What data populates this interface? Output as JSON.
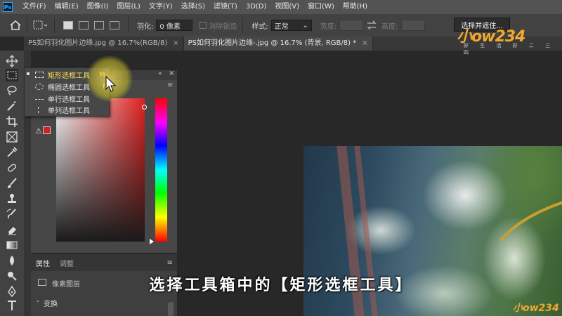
{
  "app": {
    "logo": "Ps"
  },
  "menu": [
    "文件(F)",
    "编辑(E)",
    "图像(I)",
    "图层(L)",
    "文字(Y)",
    "选择(S)",
    "滤镜(T)",
    "3D(D)",
    "视图(V)",
    "窗口(W)",
    "帮助(H)"
  ],
  "options": {
    "feather_label": "羽化:",
    "feather_value": "0 像素",
    "antialias_label": "消除锯齿",
    "style_label": "样式:",
    "style_value": "正常",
    "width_label": "宽度:",
    "height_label": "高度:",
    "select_mask_label": "选择并遮住..."
  },
  "tabs": [
    {
      "label": "PS如何羽化图片边缘.jpg @ 16.7%(RGB/8)",
      "close": "×"
    },
    {
      "label": "PS如何羽化图片边缘-.jpg @ 16.7% (背景, RGB/8) *",
      "close": "×"
    }
  ],
  "flyout": {
    "items": [
      {
        "label": "矩形选框工具",
        "key": "M"
      },
      {
        "label": "椭圆选框工具",
        "key": "M"
      },
      {
        "label": "单行选框工具",
        "key": ""
      },
      {
        "label": "单列选框工具",
        "key": ""
      }
    ]
  },
  "properties": {
    "tab_properties": "属性",
    "tab_adjust": "调整",
    "pixel_layer": "像素图层",
    "transform": "变换"
  },
  "caption": "选择工具箱中的【矩形选框工具】",
  "watermark": {
    "top": "小ow234",
    "sub": "好 生 活 好 二 三 四",
    "bottom": "小ow234"
  },
  "colors": {
    "accent": "#31a8ff",
    "highlight": "#ffe35a",
    "watermark": "#f0a830"
  }
}
